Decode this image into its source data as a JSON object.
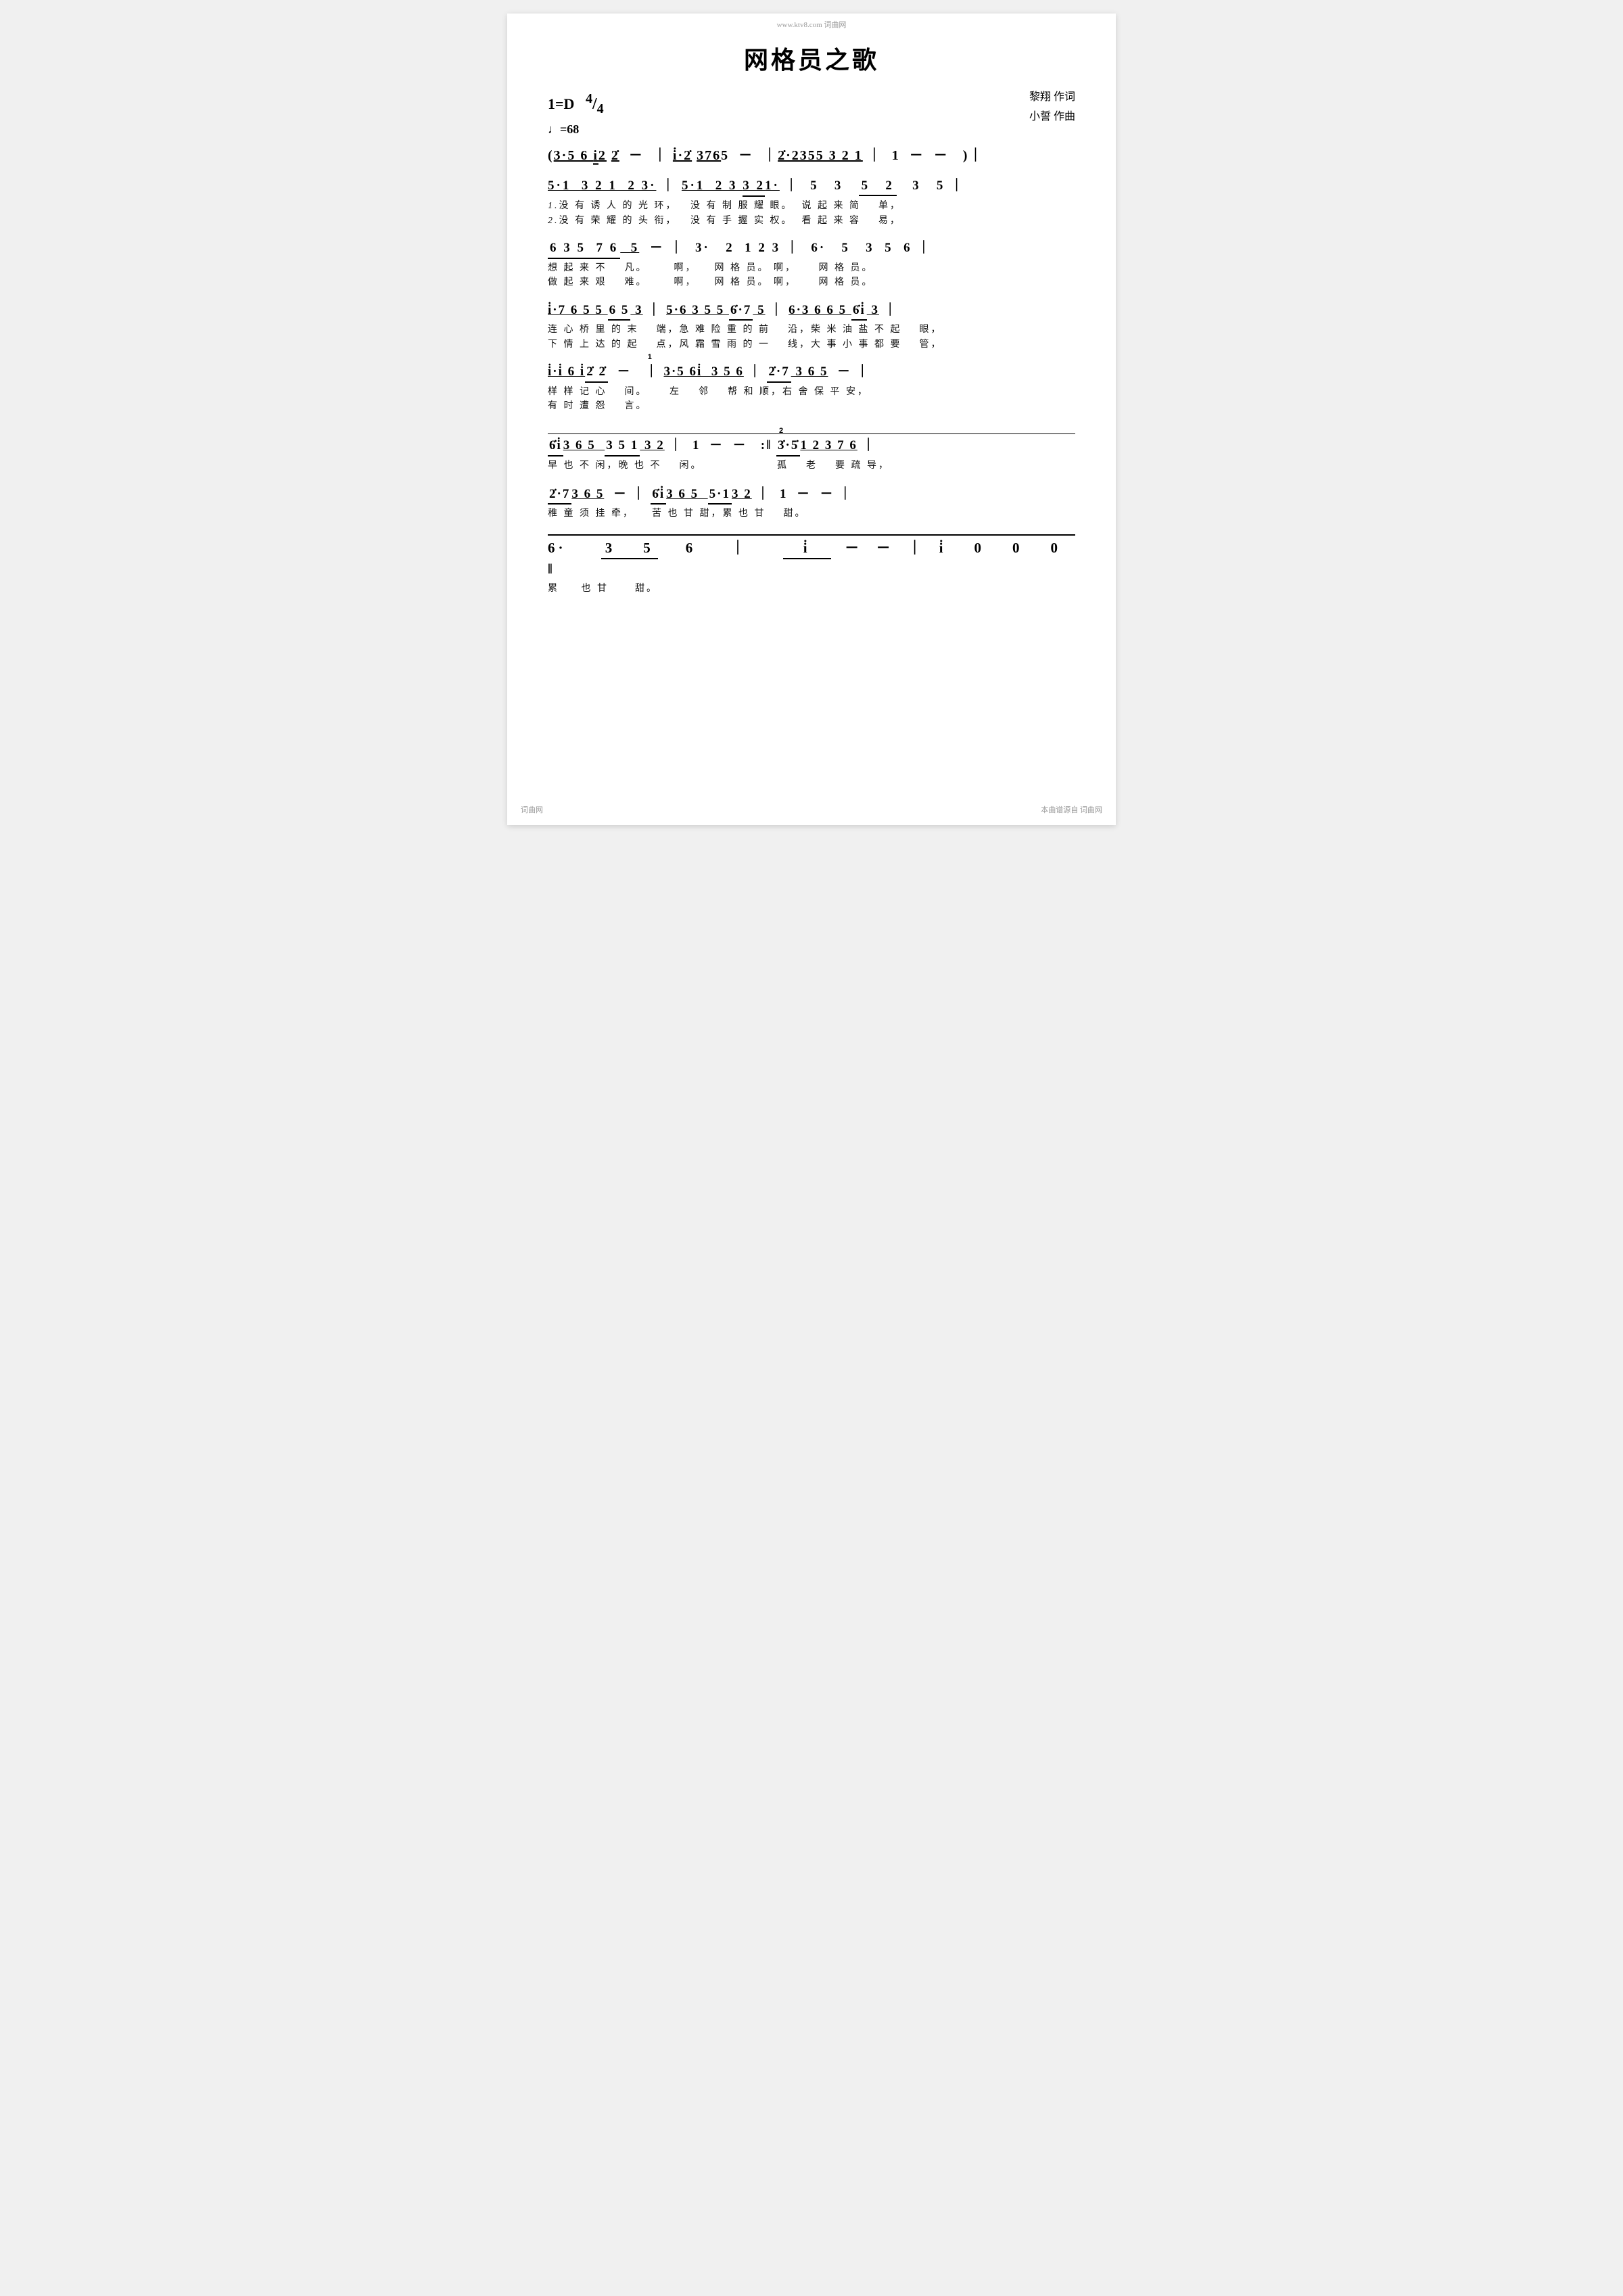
{
  "page": {
    "title": "网格员之歌",
    "watermark_top": "www.ktv8.com 词曲网",
    "watermark_bottom_right": "本曲谱源自 词曲网",
    "watermark_bottom_left": "词曲网",
    "key": "1=D",
    "time_signature": "4/4",
    "tempo": "♩=68",
    "lyricist_label": "黎翔  作词",
    "composer_label": "小誓  作曲"
  }
}
